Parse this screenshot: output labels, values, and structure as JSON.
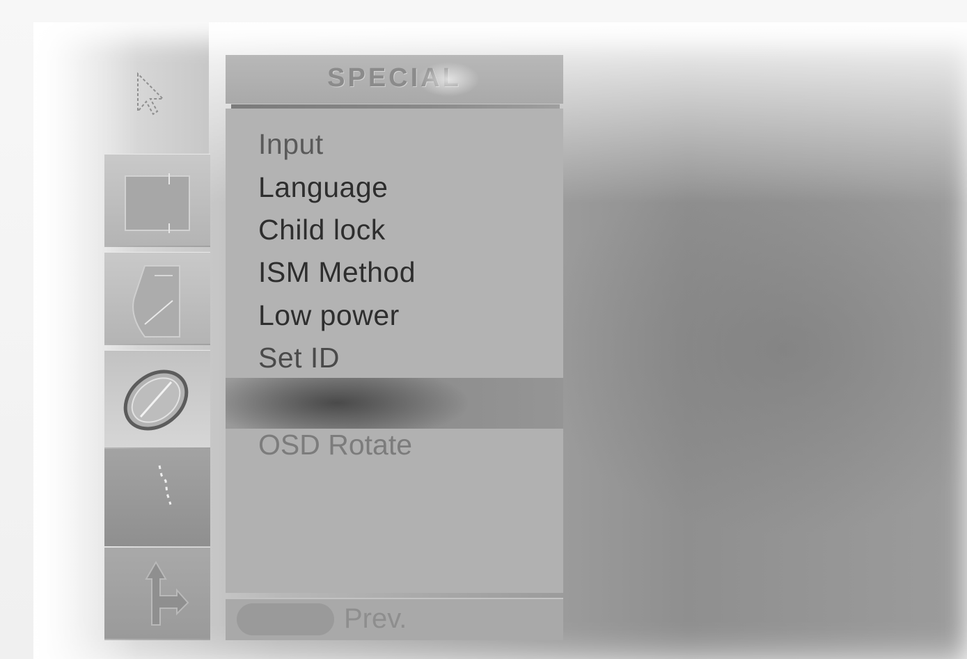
{
  "menu": {
    "title": "SPECIAL",
    "items": [
      {
        "label": "Input",
        "state": "dimmed"
      },
      {
        "label": "Language",
        "state": "normal"
      },
      {
        "label": "Child lock",
        "state": "normal"
      },
      {
        "label": "ISM Method",
        "state": "normal"
      },
      {
        "label": "Low power",
        "state": "normal"
      },
      {
        "label": "Set ID",
        "state": "normal"
      }
    ],
    "lower_items": [
      {
        "label": "OSD Rotate",
        "state": "dimmed"
      }
    ]
  },
  "footer": {
    "prev_label": "Prev."
  },
  "side_tabs": [
    {
      "icon": "screen-icon"
    },
    {
      "icon": "sound-icon"
    },
    {
      "icon": "time-icon"
    },
    {
      "icon": "special-icon",
      "selected": true
    },
    {
      "icon": "adjust-icon"
    }
  ],
  "cursor": {
    "icon": "pointer-cursor-icon"
  }
}
